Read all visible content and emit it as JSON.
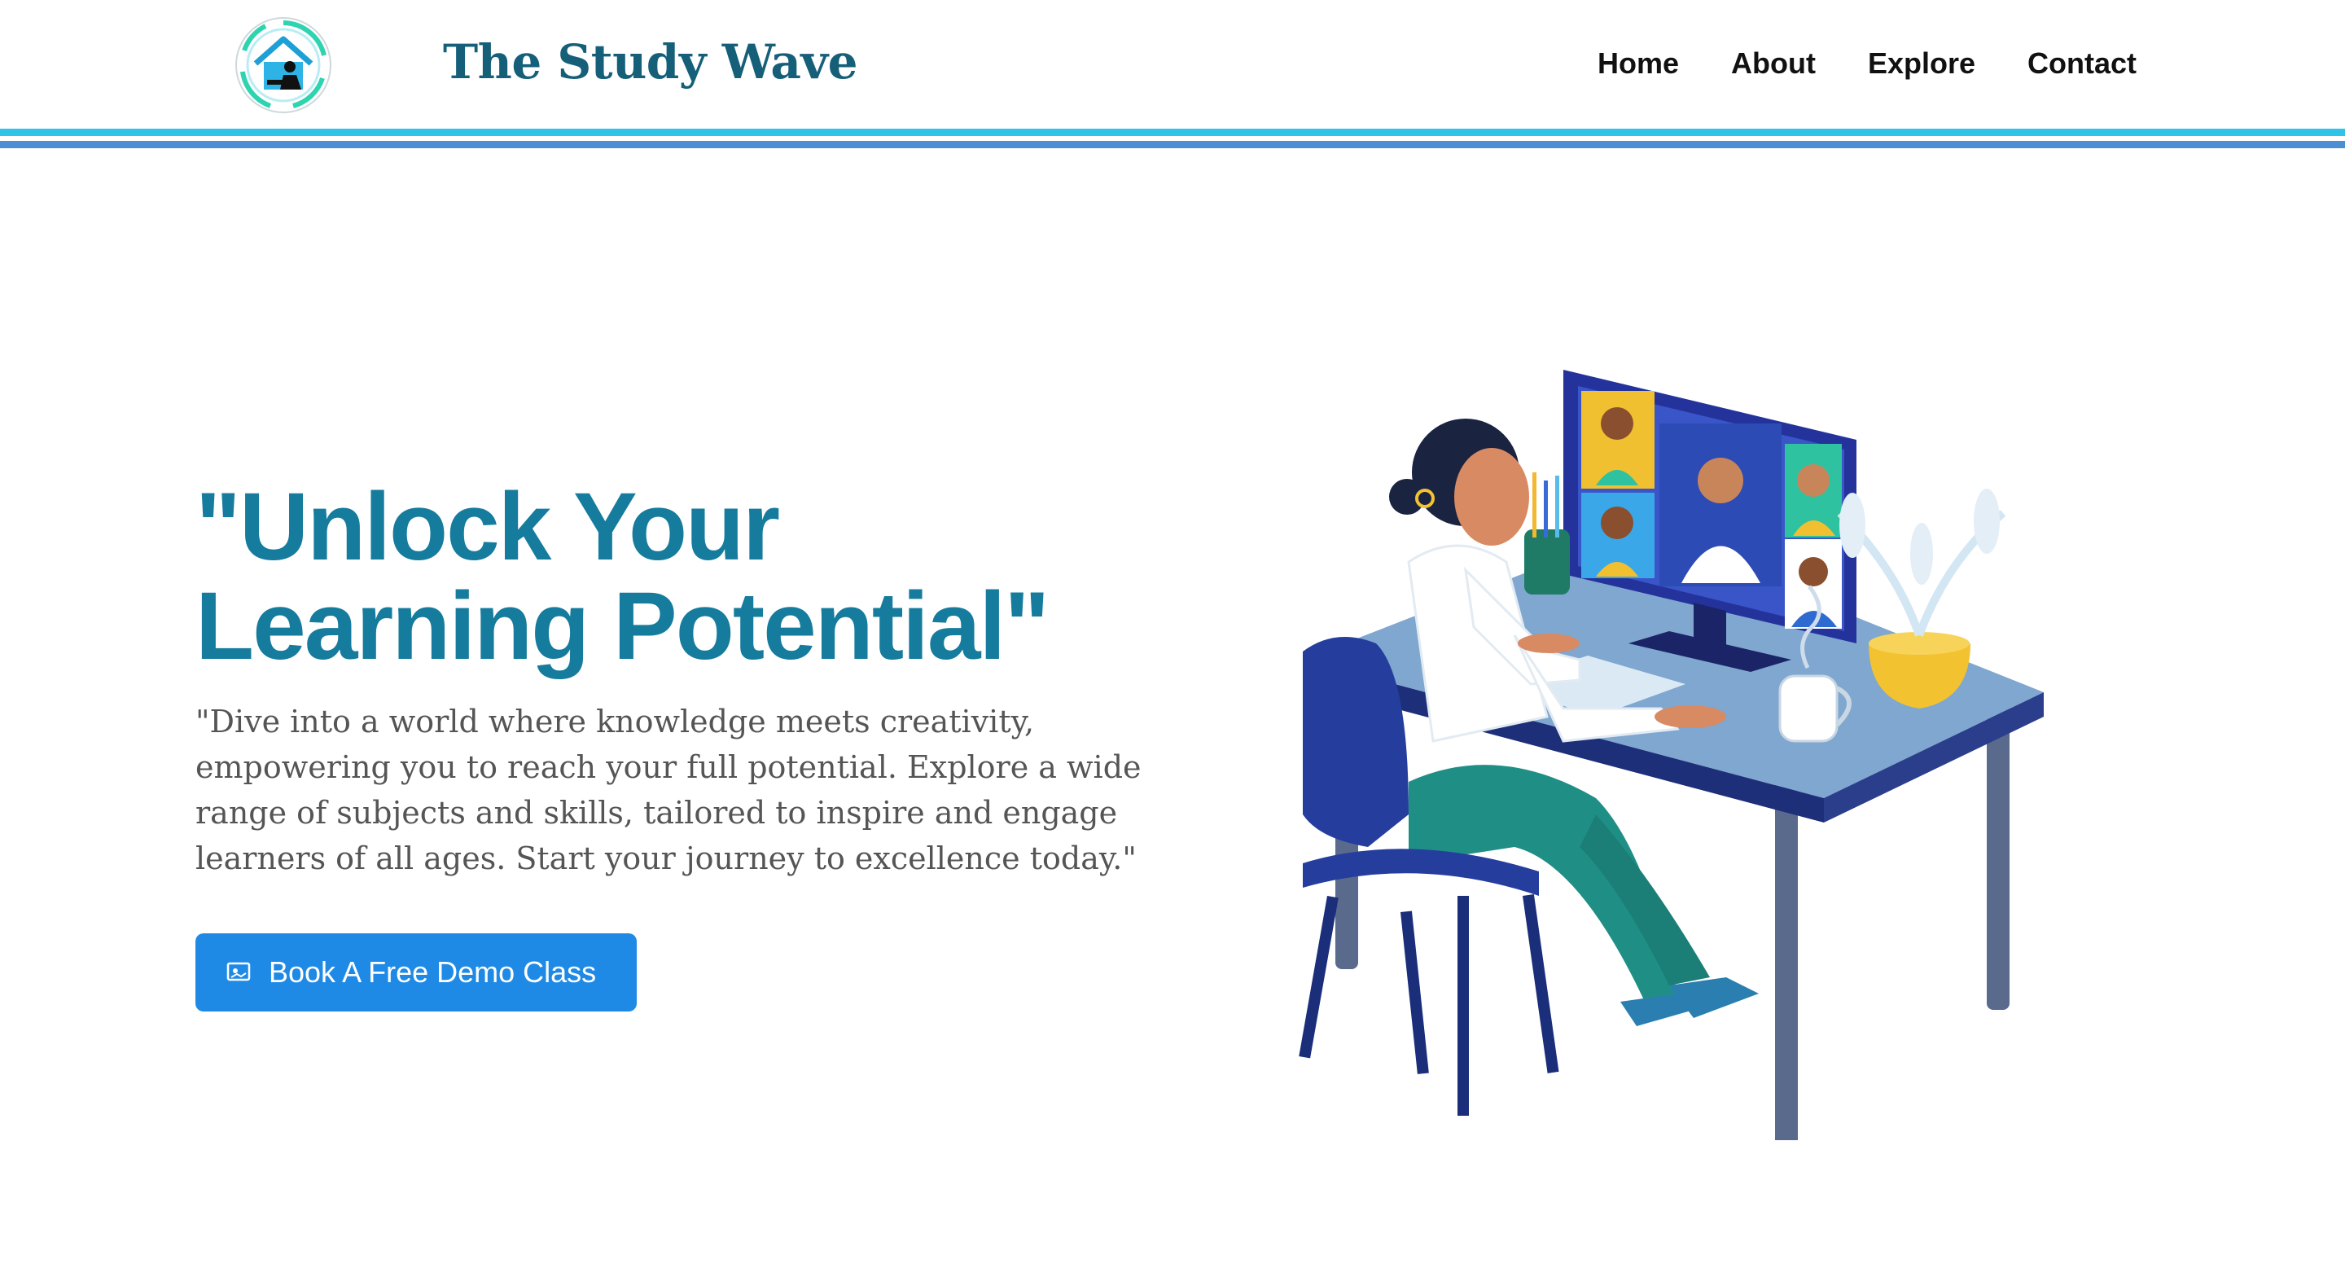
{
  "header": {
    "brand": "The Study Wave",
    "nav": [
      "Home",
      "About",
      "Explore",
      "Contact"
    ]
  },
  "hero": {
    "title_line1": "\"Unlock Your",
    "title_line2": "Learning Potential\"",
    "description": "\"Dive into a world where knowledge meets creativity, empowering you to reach your full potential. Explore a wide range of subjects and skills, tailored to inspire and engage learners of all ages. Start your journey to excellence today.\"",
    "cta_label": "Book A Free Demo Class"
  },
  "icons": {
    "logo": "house-study-logo-icon",
    "cta": "screen-icon"
  },
  "colors": {
    "brand": "#155f79",
    "title": "#167c9d",
    "cta_bg": "#1f8ae5",
    "rule_top": "#2ec3e8",
    "rule_bottom": "#4a8ed4"
  }
}
